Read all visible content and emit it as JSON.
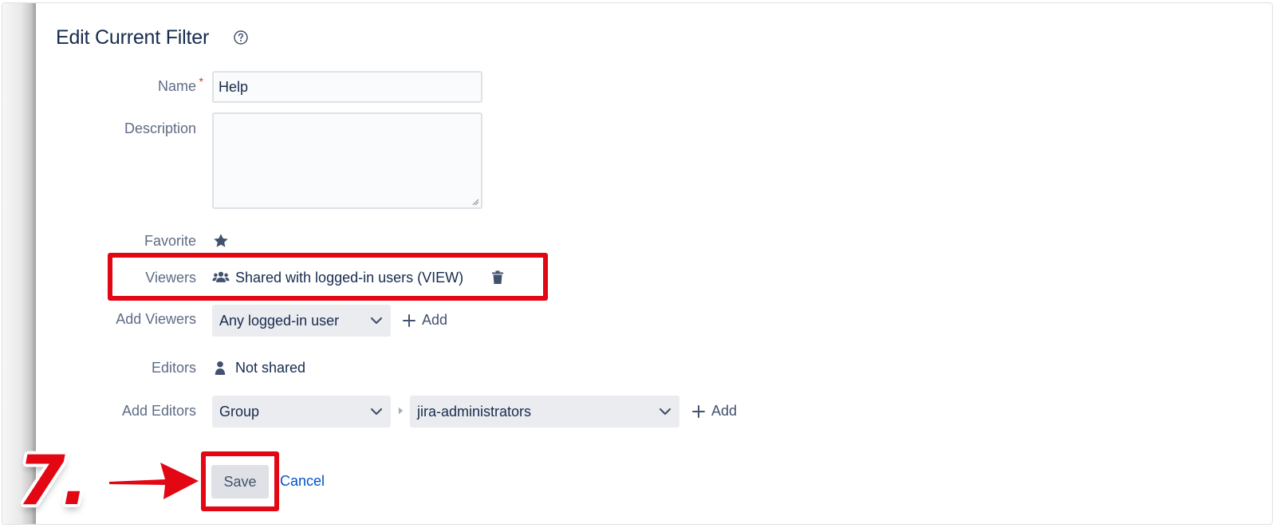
{
  "header": {
    "title": "Edit Current Filter",
    "help_icon": "question-circle-icon"
  },
  "form": {
    "name": {
      "label": "Name",
      "required_marker": "*",
      "value": "Help"
    },
    "description": {
      "label": "Description",
      "value": ""
    },
    "favorite": {
      "label": "Favorite",
      "icon": "star-icon"
    },
    "viewers": {
      "label": "Viewers",
      "value": "Shared with logged-in users (VIEW)",
      "icon": "users-icon",
      "delete_icon": "trash-icon"
    },
    "add_viewers": {
      "label": "Add Viewers",
      "select_value": "Any logged-in user",
      "add_label": "Add"
    },
    "editors": {
      "label": "Editors",
      "value": "Not shared",
      "icon": "user-icon"
    },
    "add_editors": {
      "label": "Add Editors",
      "type_value": "Group",
      "group_value": "jira-administrators",
      "add_label": "Add"
    }
  },
  "actions": {
    "save_label": "Save",
    "cancel_label": "Cancel"
  },
  "annotation": {
    "step": "7.",
    "highlight_color": "#e30613"
  },
  "colors": {
    "primary_text": "#172b4d",
    "label_text": "#5e6c84",
    "link": "#0052cc",
    "required": "#de350b"
  }
}
